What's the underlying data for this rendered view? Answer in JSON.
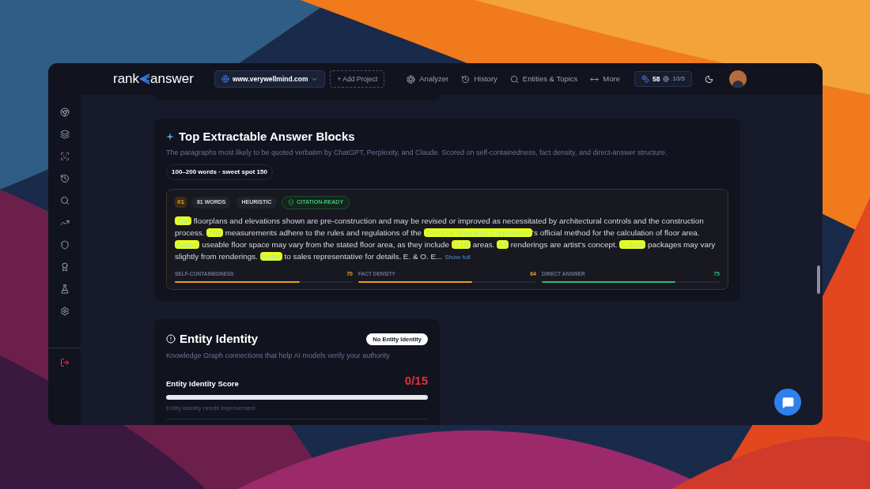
{
  "header": {
    "logo_left": "rank",
    "logo_right": "answer",
    "project": "www.verywellmind.com",
    "add_project": "+ Add Project",
    "nav": [
      {
        "label": "Analyzer",
        "kind": "analyzer"
      },
      {
        "label": "History",
        "kind": "history"
      },
      {
        "label": "Entities & Topics",
        "kind": "search"
      },
      {
        "label": "More",
        "kind": "more"
      }
    ],
    "credits": "58",
    "quota": "10/5"
  },
  "sidebar": {
    "items": [
      {
        "kind": "chrome"
      },
      {
        "kind": "layers"
      },
      {
        "kind": "scan"
      },
      {
        "kind": "history"
      },
      {
        "kind": "search"
      },
      {
        "kind": "trend"
      },
      {
        "kind": "shield"
      },
      {
        "kind": "award"
      },
      {
        "kind": "flask"
      },
      {
        "kind": "settings"
      }
    ],
    "logout": {
      "kind": "logout"
    }
  },
  "answer_blocks": {
    "title": "Top Extractable Answer Blocks",
    "subtitle": "The paragraphs most likely to be quoted verbatim by ChatGPT, Perplexity, and Claude. Scored on self-containedness, fact density, and direct-answer structure.",
    "range_badge": "100–200 words · sweet spot 150",
    "blocks": [
      {
        "rank": "#1",
        "words": "81 WORDS",
        "method": "HEURISTIC",
        "status": "CITATION-READY",
        "segments": [
          {
            "text": "The",
            "highlighted": true
          },
          {
            "text": " floorplans and elevations shown are pre-construction and may be revised or improved as necessitated by architectural controls and the construction process. ",
            "highlighted": false
          },
          {
            "text": "The",
            "highlighted": true
          },
          {
            "text": " measurements adhere to the rules and regulations of the ",
            "highlighted": false
          },
          {
            "text": "TARION Warranty Corporation",
            "highlighted": true
          },
          {
            "text": "'s official method for the calculation of floor area. ",
            "highlighted": false
          },
          {
            "text": "Actual",
            "highlighted": true
          },
          {
            "text": " useable floor space may vary from the stated floor area, as they include ",
            "highlighted": false
          },
          {
            "text": "OTB",
            "highlighted": true
          },
          {
            "text": " areas. ",
            "highlighted": false
          },
          {
            "text": "All",
            "highlighted": true
          },
          {
            "text": " renderings are artist's concept. ",
            "highlighted": false
          },
          {
            "text": "Colour",
            "highlighted": true
          },
          {
            "text": " packages may vary slightly from renderings. ",
            "highlighted": false
          },
          {
            "text": "Refer",
            "highlighted": true
          },
          {
            "text": " to sales representative for details. E. & O. E...",
            "highlighted": false
          }
        ],
        "show_full": "Show full",
        "metrics": [
          {
            "label": "SELF-CONTAINEDNESS",
            "value": "70",
            "level": 0.7,
            "color": "#e89b2c"
          },
          {
            "label": "FACT DENSITY",
            "value": "64",
            "level": 0.64,
            "color": "#e89b2c"
          },
          {
            "label": "DIRECT ANSWER",
            "value": "75",
            "level": 0.75,
            "color": "#2fb67a"
          }
        ]
      }
    ]
  },
  "entity_identity": {
    "title": "Entity Identity",
    "badge": "No Entity Identity",
    "subtitle": "Knowledge Graph connections that help AI models verify your authority",
    "score_label": "Entity Identity Score",
    "score": "0/15",
    "level": 0,
    "note": "Entity identity needs improvement"
  }
}
